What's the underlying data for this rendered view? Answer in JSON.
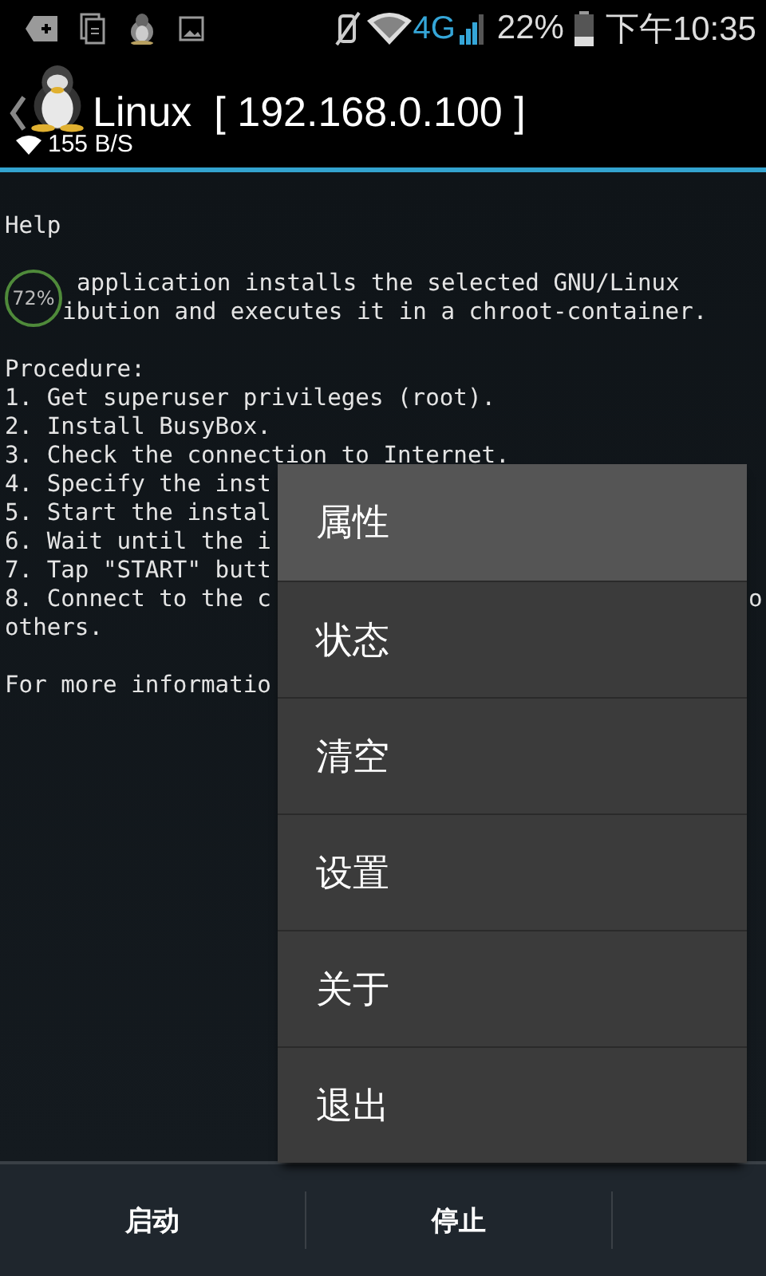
{
  "status_bar": {
    "network": "4G",
    "battery": "22%",
    "time": "下午10:35"
  },
  "action_bar": {
    "title": "Linux",
    "address": "[ 192.168.0.100 ]",
    "speed": "155 B/S"
  },
  "terminal": {
    "lines_before": [
      {
        "kind": "text",
        "text": "Help"
      },
      {
        "kind": "blank"
      }
    ],
    "badge_block": {
      "badge": "72%",
      "lines": [
        {
          "kind": "text",
          "text": "application installs the selected GNU/Linux"
        },
        {
          "kind": "text",
          "text": "ibution and executes it in a chroot-container."
        }
      ]
    },
    "lines_after": [
      {
        "kind": "blank"
      },
      {
        "kind": "text",
        "text": "Procedure:"
      },
      {
        "kind": "text",
        "text": "1. Get superuser privileges (root)."
      },
      {
        "kind": "text",
        "text": "2. Install BusyBox."
      },
      {
        "kind": "text",
        "text": "3. Check the connection to Internet."
      },
      {
        "kind": "text",
        "text": "4. Specify the inst"
      },
      {
        "kind": "text",
        "text": "5. Start the instal"
      },
      {
        "kind": "text",
        "text": "6. Wait until the i"
      },
      {
        "kind": "text",
        "text": "7. Tap \"START\" butt"
      },
      {
        "kind": "text",
        "text": "8. Connect to the c",
        "tail": "o"
      },
      {
        "kind": "text",
        "text": "others."
      },
      {
        "kind": "blank"
      },
      {
        "kind": "text",
        "text": "For more informatio"
      }
    ]
  },
  "menu": {
    "items": [
      {
        "label": "属性",
        "selected": true
      },
      {
        "label": "状态",
        "selected": false
      },
      {
        "label": "清空",
        "selected": false
      },
      {
        "label": "设置",
        "selected": false
      },
      {
        "label": "关于",
        "selected": false
      },
      {
        "label": "退出",
        "selected": false
      }
    ]
  },
  "bottom_buttons": [
    {
      "label": "启动"
    },
    {
      "label": "停止"
    }
  ]
}
